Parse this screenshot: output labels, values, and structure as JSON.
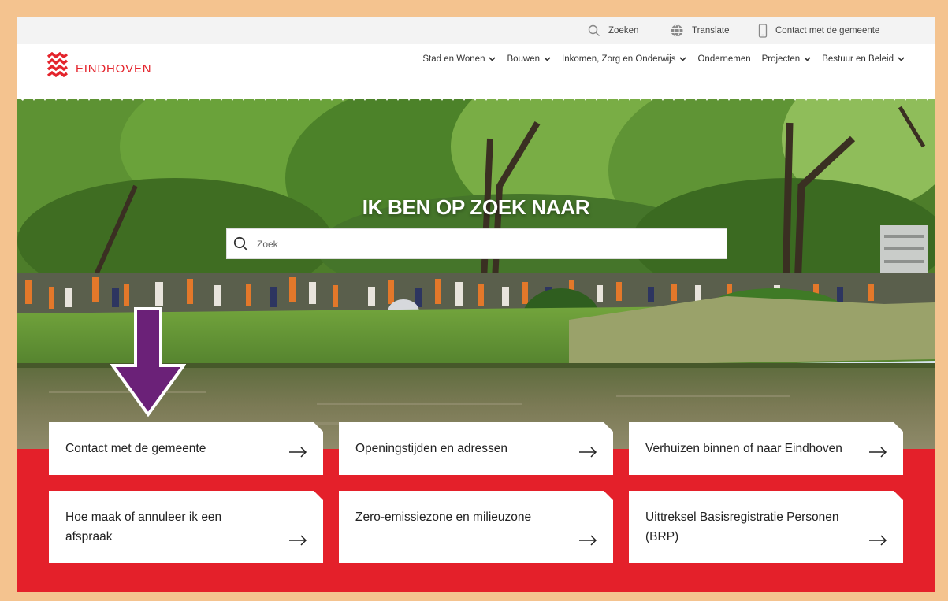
{
  "utility_bar": {
    "search_label": "Zoeken",
    "translate_label": "Translate",
    "contact_label": "Contact met de gemeente"
  },
  "header": {
    "logo_text": "EINDHOVEN",
    "nav": [
      {
        "label": "Stad en Wonen",
        "has_dropdown": true
      },
      {
        "label": "Bouwen",
        "has_dropdown": true
      },
      {
        "label": "Inkomen, Zorg en Onderwijs",
        "has_dropdown": true
      },
      {
        "label": "Ondernemen",
        "has_dropdown": false
      },
      {
        "label": "Projecten",
        "has_dropdown": true
      },
      {
        "label": "Bestuur en Beleid",
        "has_dropdown": true
      }
    ]
  },
  "hero": {
    "title": "IK BEN OP ZOEK NAAR",
    "search_placeholder": "Zoek"
  },
  "cards": [
    {
      "label": "Contact met de gemeente"
    },
    {
      "label": "Openingstijden en adressen"
    },
    {
      "label": "Verhuizen binnen of naar Eindhoven"
    },
    {
      "label": "Hoe maak of annuleer ik een afspraak"
    },
    {
      "label": "Zero-emissiezone en milieuzone"
    },
    {
      "label": "Uittreksel Basisregistratie Personen (BRP)"
    }
  ],
  "colors": {
    "brand_red": "#e4202a",
    "frame": "#f4c38f",
    "annotation_arrow": "#6b2178"
  },
  "icons": [
    "search-icon",
    "globe-icon",
    "phone-icon",
    "eindhoven-logo-icon",
    "chevron-down-icon",
    "arrow-right-icon",
    "annotation-arrow-icon"
  ]
}
